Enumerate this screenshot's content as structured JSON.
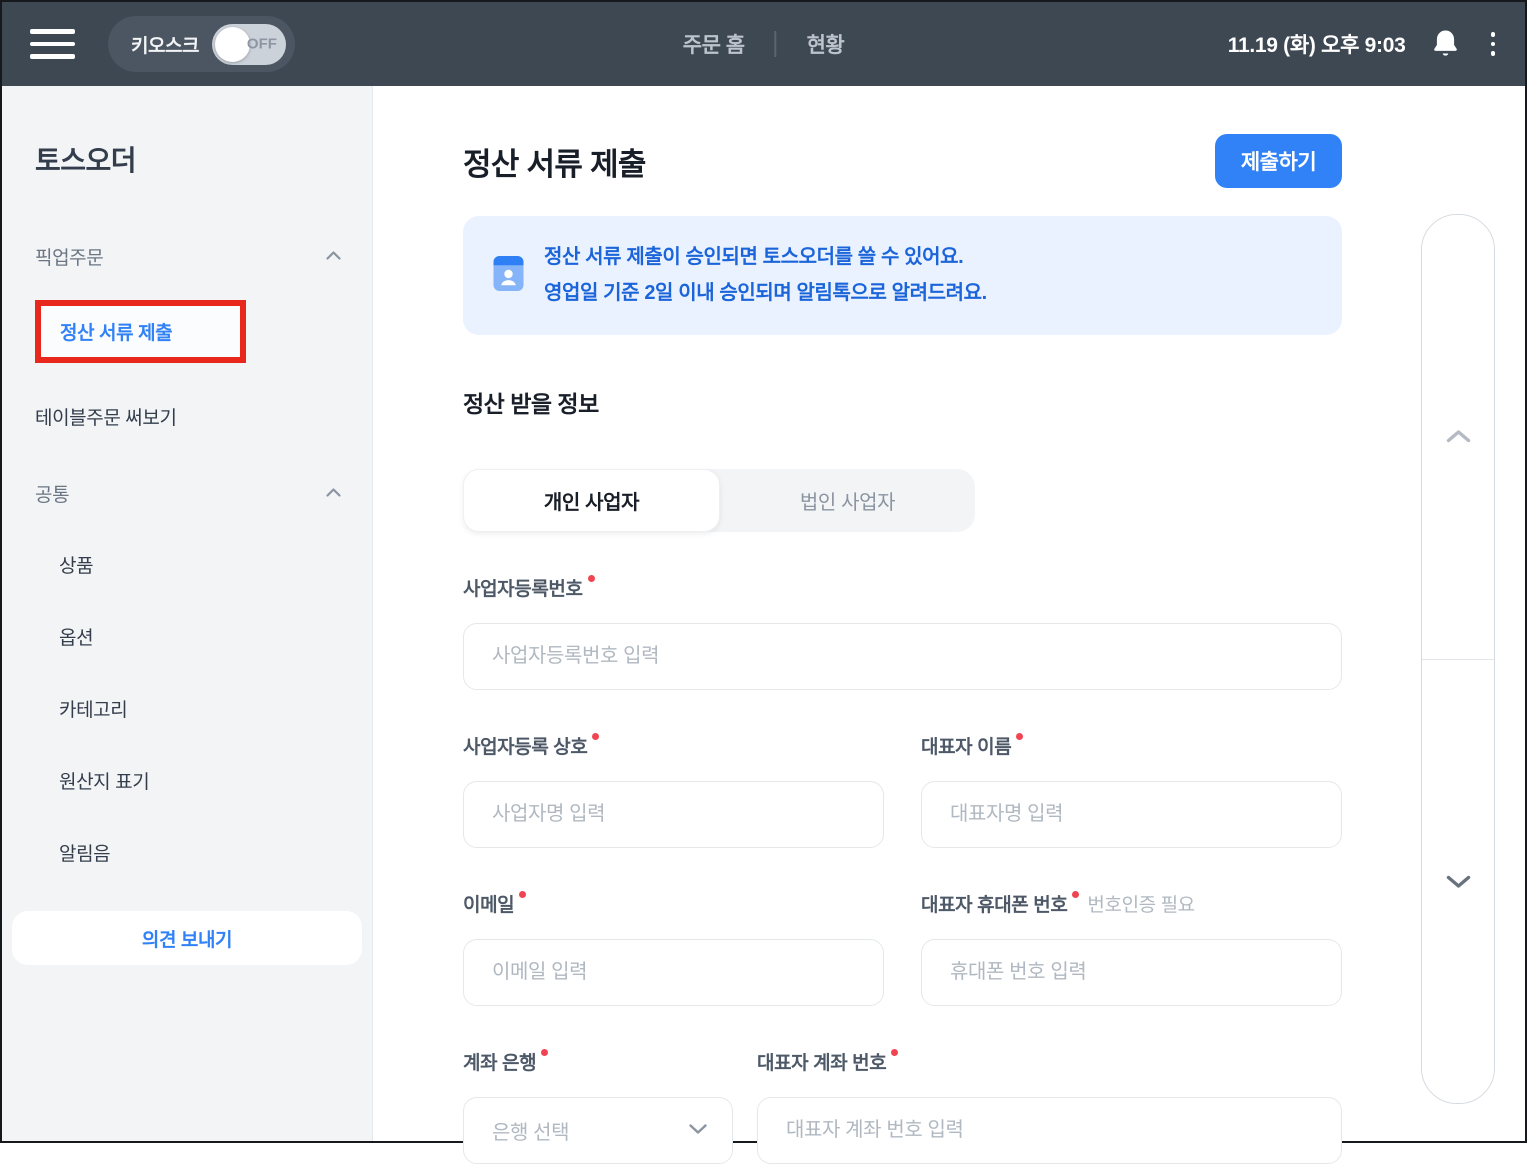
{
  "topbar": {
    "kiosk_label": "키오스크",
    "kiosk_state": "OFF",
    "nav_home": "주문 홈",
    "nav_status": "현황",
    "datetime": "11.19 (화) 오후 9:03"
  },
  "sidebar": {
    "title": "토스오더",
    "group_pickup": "픽업주문",
    "active_item": "정산 서류 제출",
    "table_order": "테이블주문 써보기",
    "group_common": "공통",
    "common_items": [
      "상품",
      "옵션",
      "카테고리",
      "원산지 표기",
      "알림음"
    ],
    "feedback_button": "의견 보내기"
  },
  "main": {
    "title": "정산 서류 제출",
    "submit_button": "제출하기",
    "notice_line1": "정산 서류 제출이 승인되면 토스오더를 쓸 수 있어요.",
    "notice_line2": "영업일 기준 2일 이내 승인되며 알림톡으로 알려드려요.",
    "section_title": "정산 받을 정보",
    "tab_individual": "개인 사업자",
    "tab_corporate": "법인 사업자",
    "fields": {
      "biz_number": {
        "label": "사업자등록번호",
        "placeholder": "사업자등록번호 입력"
      },
      "biz_name": {
        "label": "사업자등록 상호",
        "placeholder": "사업자명 입력"
      },
      "ceo_name": {
        "label": "대표자 이름",
        "placeholder": "대표자명 입력"
      },
      "email": {
        "label": "이메일",
        "placeholder": "이메일 입력"
      },
      "phone": {
        "label": "대표자 휴대폰 번호",
        "note": "번호인증 필요",
        "placeholder": "휴대폰 번호 입력"
      },
      "bank": {
        "label": "계좌 은행",
        "placeholder": "은행 선택"
      },
      "account": {
        "label": "대표자 계좌 번호",
        "placeholder": "대표자 계좌 번호 입력"
      }
    }
  },
  "colors": {
    "accent_blue": "#3182f6",
    "notice_text": "#1b64da",
    "notice_bg": "#e9f2fe",
    "annotation_red": "#e8271d",
    "required_red": "#f04452",
    "topbar_bg": "#3e4853",
    "sidebar_bg": "#f2f4f6"
  }
}
